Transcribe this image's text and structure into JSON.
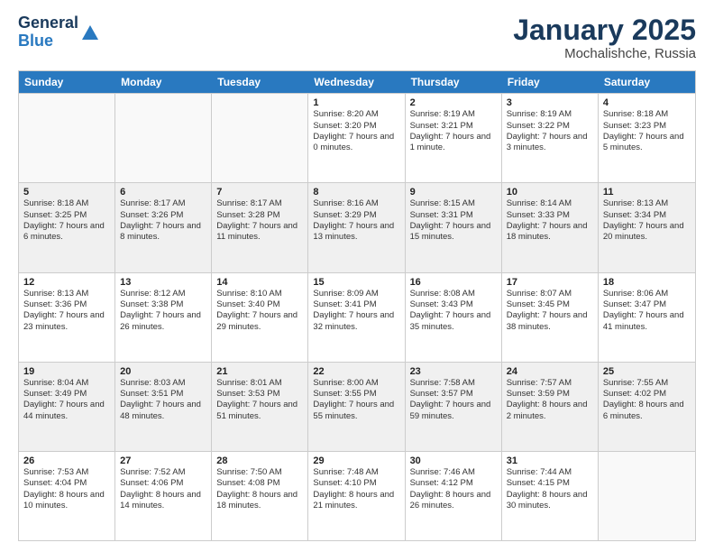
{
  "logo": {
    "general": "General",
    "blue": "Blue"
  },
  "title": "January 2025",
  "location": "Mochalishche, Russia",
  "days_of_week": [
    "Sunday",
    "Monday",
    "Tuesday",
    "Wednesday",
    "Thursday",
    "Friday",
    "Saturday"
  ],
  "weeks": [
    [
      {
        "day": "",
        "sunrise": "",
        "sunset": "",
        "daylight": "",
        "empty": true
      },
      {
        "day": "",
        "sunrise": "",
        "sunset": "",
        "daylight": "",
        "empty": true
      },
      {
        "day": "",
        "sunrise": "",
        "sunset": "",
        "daylight": "",
        "empty": true
      },
      {
        "day": "1",
        "sunrise": "Sunrise: 8:20 AM",
        "sunset": "Sunset: 3:20 PM",
        "daylight": "Daylight: 7 hours and 0 minutes.",
        "empty": false
      },
      {
        "day": "2",
        "sunrise": "Sunrise: 8:19 AM",
        "sunset": "Sunset: 3:21 PM",
        "daylight": "Daylight: 7 hours and 1 minute.",
        "empty": false
      },
      {
        "day": "3",
        "sunrise": "Sunrise: 8:19 AM",
        "sunset": "Sunset: 3:22 PM",
        "daylight": "Daylight: 7 hours and 3 minutes.",
        "empty": false
      },
      {
        "day": "4",
        "sunrise": "Sunrise: 8:18 AM",
        "sunset": "Sunset: 3:23 PM",
        "daylight": "Daylight: 7 hours and 5 minutes.",
        "empty": false
      }
    ],
    [
      {
        "day": "5",
        "sunrise": "Sunrise: 8:18 AM",
        "sunset": "Sunset: 3:25 PM",
        "daylight": "Daylight: 7 hours and 6 minutes.",
        "empty": false
      },
      {
        "day": "6",
        "sunrise": "Sunrise: 8:17 AM",
        "sunset": "Sunset: 3:26 PM",
        "daylight": "Daylight: 7 hours and 8 minutes.",
        "empty": false
      },
      {
        "day": "7",
        "sunrise": "Sunrise: 8:17 AM",
        "sunset": "Sunset: 3:28 PM",
        "daylight": "Daylight: 7 hours and 11 minutes.",
        "empty": false
      },
      {
        "day": "8",
        "sunrise": "Sunrise: 8:16 AM",
        "sunset": "Sunset: 3:29 PM",
        "daylight": "Daylight: 7 hours and 13 minutes.",
        "empty": false
      },
      {
        "day": "9",
        "sunrise": "Sunrise: 8:15 AM",
        "sunset": "Sunset: 3:31 PM",
        "daylight": "Daylight: 7 hours and 15 minutes.",
        "empty": false
      },
      {
        "day": "10",
        "sunrise": "Sunrise: 8:14 AM",
        "sunset": "Sunset: 3:33 PM",
        "daylight": "Daylight: 7 hours and 18 minutes.",
        "empty": false
      },
      {
        "day": "11",
        "sunrise": "Sunrise: 8:13 AM",
        "sunset": "Sunset: 3:34 PM",
        "daylight": "Daylight: 7 hours and 20 minutes.",
        "empty": false
      }
    ],
    [
      {
        "day": "12",
        "sunrise": "Sunrise: 8:13 AM",
        "sunset": "Sunset: 3:36 PM",
        "daylight": "Daylight: 7 hours and 23 minutes.",
        "empty": false
      },
      {
        "day": "13",
        "sunrise": "Sunrise: 8:12 AM",
        "sunset": "Sunset: 3:38 PM",
        "daylight": "Daylight: 7 hours and 26 minutes.",
        "empty": false
      },
      {
        "day": "14",
        "sunrise": "Sunrise: 8:10 AM",
        "sunset": "Sunset: 3:40 PM",
        "daylight": "Daylight: 7 hours and 29 minutes.",
        "empty": false
      },
      {
        "day": "15",
        "sunrise": "Sunrise: 8:09 AM",
        "sunset": "Sunset: 3:41 PM",
        "daylight": "Daylight: 7 hours and 32 minutes.",
        "empty": false
      },
      {
        "day": "16",
        "sunrise": "Sunrise: 8:08 AM",
        "sunset": "Sunset: 3:43 PM",
        "daylight": "Daylight: 7 hours and 35 minutes.",
        "empty": false
      },
      {
        "day": "17",
        "sunrise": "Sunrise: 8:07 AM",
        "sunset": "Sunset: 3:45 PM",
        "daylight": "Daylight: 7 hours and 38 minutes.",
        "empty": false
      },
      {
        "day": "18",
        "sunrise": "Sunrise: 8:06 AM",
        "sunset": "Sunset: 3:47 PM",
        "daylight": "Daylight: 7 hours and 41 minutes.",
        "empty": false
      }
    ],
    [
      {
        "day": "19",
        "sunrise": "Sunrise: 8:04 AM",
        "sunset": "Sunset: 3:49 PM",
        "daylight": "Daylight: 7 hours and 44 minutes.",
        "empty": false
      },
      {
        "day": "20",
        "sunrise": "Sunrise: 8:03 AM",
        "sunset": "Sunset: 3:51 PM",
        "daylight": "Daylight: 7 hours and 48 minutes.",
        "empty": false
      },
      {
        "day": "21",
        "sunrise": "Sunrise: 8:01 AM",
        "sunset": "Sunset: 3:53 PM",
        "daylight": "Daylight: 7 hours and 51 minutes.",
        "empty": false
      },
      {
        "day": "22",
        "sunrise": "Sunrise: 8:00 AM",
        "sunset": "Sunset: 3:55 PM",
        "daylight": "Daylight: 7 hours and 55 minutes.",
        "empty": false
      },
      {
        "day": "23",
        "sunrise": "Sunrise: 7:58 AM",
        "sunset": "Sunset: 3:57 PM",
        "daylight": "Daylight: 7 hours and 59 minutes.",
        "empty": false
      },
      {
        "day": "24",
        "sunrise": "Sunrise: 7:57 AM",
        "sunset": "Sunset: 3:59 PM",
        "daylight": "Daylight: 8 hours and 2 minutes.",
        "empty": false
      },
      {
        "day": "25",
        "sunrise": "Sunrise: 7:55 AM",
        "sunset": "Sunset: 4:02 PM",
        "daylight": "Daylight: 8 hours and 6 minutes.",
        "empty": false
      }
    ],
    [
      {
        "day": "26",
        "sunrise": "Sunrise: 7:53 AM",
        "sunset": "Sunset: 4:04 PM",
        "daylight": "Daylight: 8 hours and 10 minutes.",
        "empty": false
      },
      {
        "day": "27",
        "sunrise": "Sunrise: 7:52 AM",
        "sunset": "Sunset: 4:06 PM",
        "daylight": "Daylight: 8 hours and 14 minutes.",
        "empty": false
      },
      {
        "day": "28",
        "sunrise": "Sunrise: 7:50 AM",
        "sunset": "Sunset: 4:08 PM",
        "daylight": "Daylight: 8 hours and 18 minutes.",
        "empty": false
      },
      {
        "day": "29",
        "sunrise": "Sunrise: 7:48 AM",
        "sunset": "Sunset: 4:10 PM",
        "daylight": "Daylight: 8 hours and 21 minutes.",
        "empty": false
      },
      {
        "day": "30",
        "sunrise": "Sunrise: 7:46 AM",
        "sunset": "Sunset: 4:12 PM",
        "daylight": "Daylight: 8 hours and 26 minutes.",
        "empty": false
      },
      {
        "day": "31",
        "sunrise": "Sunrise: 7:44 AM",
        "sunset": "Sunset: 4:15 PM",
        "daylight": "Daylight: 8 hours and 30 minutes.",
        "empty": false
      },
      {
        "day": "",
        "sunrise": "",
        "sunset": "",
        "daylight": "",
        "empty": true
      }
    ]
  ]
}
